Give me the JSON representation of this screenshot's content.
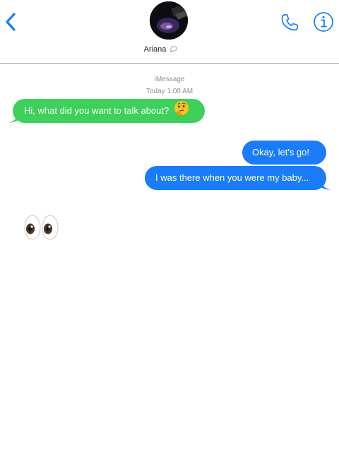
{
  "header": {
    "contact_name": "Ariana",
    "back_icon": "chevron-left-icon",
    "phone_icon": "phone-icon",
    "info_icon": "info-icon"
  },
  "thread": {
    "service": "iMessage",
    "timestamp": "Today 1:00 AM",
    "messages": [
      {
        "sender": "them",
        "text": "Hi, what did you want to talk about?",
        "emoji": "thinking-face"
      },
      {
        "sender": "me",
        "text": "Okay, let's go!"
      },
      {
        "sender": "me",
        "text": "I was there when you were my baby..."
      },
      {
        "sender": "them",
        "emoji": "eyes"
      }
    ]
  },
  "colors": {
    "accent": "#1a7cf8",
    "sent_bubble": "#1a7cf8",
    "received_bubble": "#3dd05a",
    "meta_text": "#8e8e93",
    "divider": "#9c9c9c"
  }
}
